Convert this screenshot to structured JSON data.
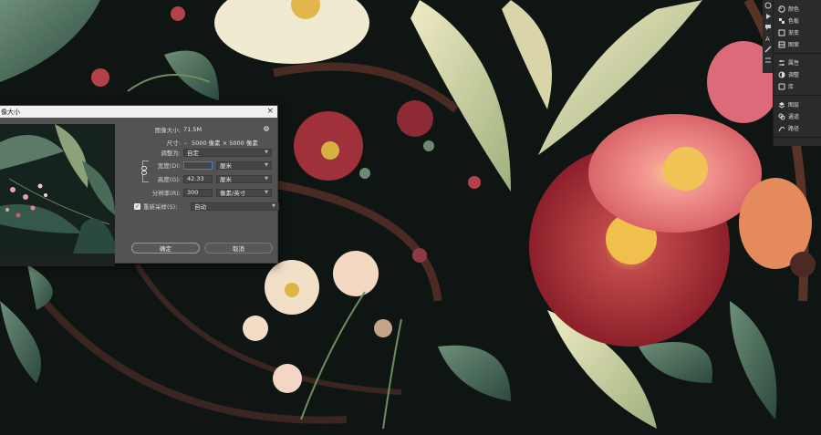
{
  "dialog": {
    "title": "像大小",
    "close_label": "×",
    "image_size_label": "图像大小:",
    "image_size_value": "71.5M",
    "dimensions_label": "尺寸:",
    "dimensions_value": "5000 像素 × 5000 像素",
    "fit_to_label": "调整为:",
    "fit_to_value": "自定",
    "width_label": "宽度(D):",
    "width_value": "",
    "width_unit": "厘米",
    "height_label": "高度(G):",
    "height_value": "42.33",
    "height_unit": "厘米",
    "resolution_label": "分辨率(R):",
    "resolution_value": "300",
    "resolution_unit": "像素/英寸",
    "resample_label": "重新采样(S):",
    "resample_checked": true,
    "resample_value": "自动",
    "ok_label": "确定",
    "cancel_label": "取消"
  },
  "right_panel": {
    "group1": [
      "颜色",
      "色板",
      "渐变",
      "图案"
    ],
    "group2": [
      "属性",
      "调整",
      "库"
    ],
    "group3": [
      "图层",
      "通道",
      "路径"
    ]
  },
  "icons": {
    "gear": "gear-icon",
    "link": "chain-link-icon"
  }
}
